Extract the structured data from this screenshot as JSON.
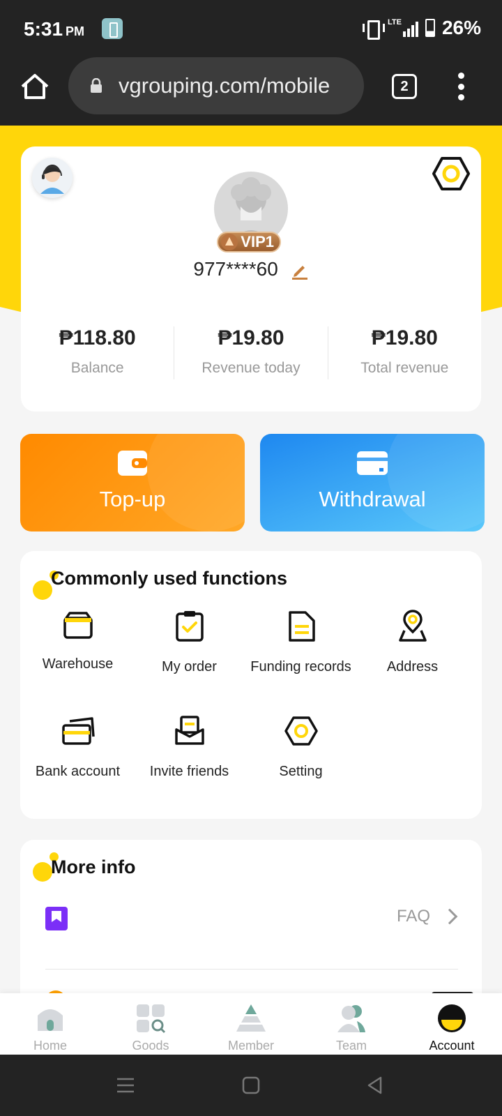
{
  "status_bar": {
    "time": "5:31",
    "ampm": "PM",
    "network": "LTE",
    "battery": "26%"
  },
  "browser": {
    "url": "vgrouping.com/mobile",
    "tab_count": "2"
  },
  "profile": {
    "vip_level": "VIP1",
    "username": "977****60",
    "stats": [
      {
        "value": "₱118.80",
        "label": "Balance"
      },
      {
        "value": "₱19.80",
        "label": "Revenue today"
      },
      {
        "value": "₱19.80",
        "label": "Total revenue"
      }
    ]
  },
  "actions": {
    "topup": "Top-up",
    "withdrawal": "Withdrawal"
  },
  "functions": {
    "title": "Commonly used functions",
    "items": [
      {
        "label": "Warehouse",
        "icon": "warehouse-icon"
      },
      {
        "label": "My order",
        "icon": "clipboard-check-icon"
      },
      {
        "label": "Funding records",
        "icon": "document-icon"
      },
      {
        "label": "Address",
        "icon": "location-pin-icon"
      },
      {
        "label": "Bank account",
        "icon": "bank-card-icon"
      },
      {
        "label": "Invite friends",
        "icon": "envelope-icon"
      },
      {
        "label": "Setting",
        "icon": "hexagon-settings-icon"
      }
    ]
  },
  "more_info": {
    "title": "More info",
    "items": [
      {
        "label": "FAQ",
        "icon": "bookmark-icon"
      }
    ]
  },
  "bottom_nav": {
    "items": [
      {
        "label": "Home",
        "icon": "home-icon"
      },
      {
        "label": "Goods",
        "icon": "goods-grid-icon"
      },
      {
        "label": "Member",
        "icon": "member-pyramid-icon"
      },
      {
        "label": "Team",
        "icon": "team-icon"
      },
      {
        "label": "Account",
        "icon": "account-icon"
      }
    ],
    "active": "Account"
  },
  "colors": {
    "brand_yellow": "#ffd60a",
    "topup_orange": "#ff8a00",
    "withdraw_blue": "#1e88f0",
    "faq_purple": "#7b2ff7"
  }
}
